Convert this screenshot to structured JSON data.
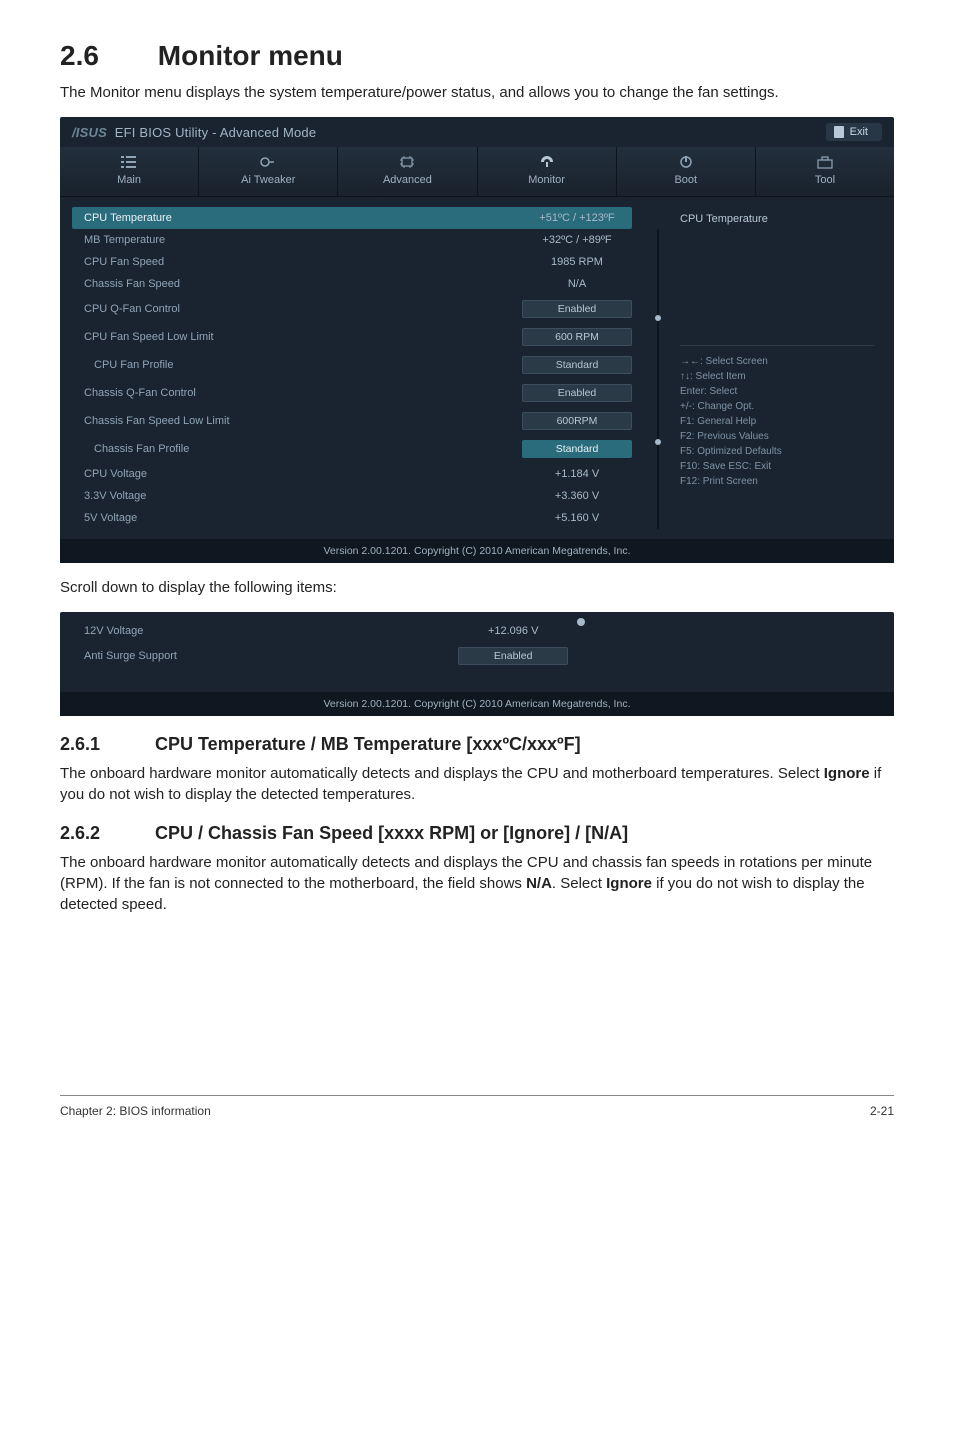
{
  "section": {
    "number": "2.6",
    "title": "Monitor menu",
    "intro": "The Monitor menu displays the system temperature/power status, and allows you to change the fan settings."
  },
  "bios_main": {
    "brand_prefix": "/ISUS",
    "brand_rest": "EFI BIOS Utility - Advanced Mode",
    "exit_label": "Exit",
    "tabs": [
      {
        "label": "Main",
        "icon": "list-icon"
      },
      {
        "label": "Ai Tweaker",
        "icon": "tweaker-icon"
      },
      {
        "label": "Advanced",
        "icon": "chip-icon"
      },
      {
        "label": "Monitor",
        "icon": "monitor-icon"
      },
      {
        "label": "Boot",
        "icon": "power-icon"
      },
      {
        "label": "Tool",
        "icon": "toolbox-icon"
      }
    ],
    "rows": [
      {
        "label": "CPU Temperature",
        "value": "+51ºC / +123ºF",
        "hl": true,
        "boxed": false
      },
      {
        "label": "MB Temperature",
        "value": "+32ºC / +89ºF",
        "boxed": false
      },
      {
        "label": "CPU Fan Speed",
        "value": "1985 RPM",
        "boxed": false
      },
      {
        "label": "Chassis Fan Speed",
        "value": "N/A",
        "boxed": false
      },
      {
        "label": "CPU Q-Fan Control",
        "value": "Enabled",
        "boxed": true
      },
      {
        "label": "CPU Fan Speed Low Limit",
        "value": "600 RPM",
        "boxed": true
      },
      {
        "label": "CPU Fan Profile",
        "value": "Standard",
        "boxed": true,
        "indent": true
      },
      {
        "label": "Chassis Q-Fan Control",
        "value": "Enabled",
        "boxed": true
      },
      {
        "label": "Chassis Fan Speed Low Limit",
        "value": "600RPM",
        "boxed": true
      },
      {
        "label": "Chassis Fan Profile",
        "value": "Standard",
        "boxed": true,
        "sel": true,
        "indent": true
      },
      {
        "label": "CPU Voltage",
        "value": "+1.184 V",
        "boxed": false
      },
      {
        "label": "3.3V Voltage",
        "value": "+3.360 V",
        "boxed": false
      },
      {
        "label": "5V Voltage",
        "value": "+5.160 V",
        "boxed": false
      }
    ],
    "right_title": "CPU Temperature",
    "help_lines": [
      "→←: Select Screen",
      "↑↓: Select Item",
      "Enter: Select",
      "+/-: Change Opt.",
      "F1: General Help",
      "F2: Previous Values",
      "F5: Optimized Defaults",
      "F10: Save   ESC: Exit",
      "F12: Print Screen"
    ],
    "footer": "Version 2.00.1201.  Copyright (C)  2010 American Megatrends, Inc."
  },
  "scroll_caption": "Scroll down to display the following items:",
  "bios_scroll": {
    "rows": [
      {
        "label": "12V Voltage",
        "value": "+12.096 V",
        "boxed": false
      },
      {
        "label": "Anti Surge Support",
        "value": "Enabled",
        "boxed": true
      }
    ],
    "footer": "Version 2.00.1201.  Copyright (C)  2010 American Megatrends, Inc."
  },
  "sub261": {
    "number": "2.6.1",
    "title": "CPU Temperature / MB Temperature [xxxºC/xxxºF]",
    "body_before": "The onboard hardware monitor automatically detects and displays the CPU and motherboard temperatures. Select ",
    "ignore": "Ignore",
    "body_after": " if you do not wish to display the detected temperatures."
  },
  "sub262": {
    "number": "2.6.2",
    "title": "CPU / Chassis Fan Speed [xxxx RPM] or [Ignore] / [N/A]",
    "body1": "The onboard hardware monitor automatically detects and displays the CPU and chassis fan speeds in rotations per minute (RPM). If the fan is not connected to the motherboard, the field shows ",
    "na": "N/A",
    "body2": ". Select ",
    "ignore": "Ignore",
    "body3": " if you do not wish to display the detected speed."
  },
  "pagefoot": {
    "left": "Chapter 2: BIOS information",
    "right": "2-21"
  }
}
